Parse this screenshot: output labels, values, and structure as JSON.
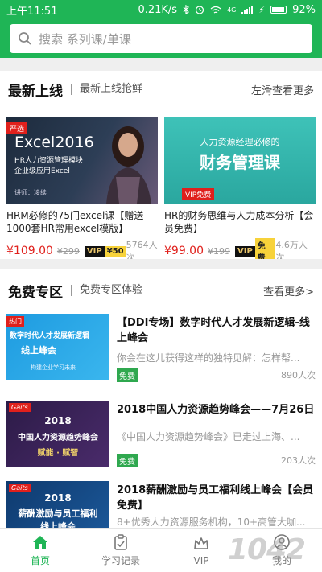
{
  "status_bar": {
    "time": "上午11:51",
    "speed": "0.21K/s",
    "net": "4G",
    "battery": "92%"
  },
  "search": {
    "placeholder": "搜索 系列课/单课"
  },
  "new_section": {
    "title": "最新上线",
    "subtitle": "最新上线抢鲜",
    "more": "左滑查看更多"
  },
  "new_courses": [
    {
      "title": "HRM必修的75门excel课【赠送1000套HR常用excel模版】",
      "price": "¥109.00",
      "old_price": "¥299",
      "vip_label": "VIP",
      "vip_value": "¥50",
      "count": "5764人次",
      "thumb": {
        "badge": "严选",
        "heading": "Excel2016",
        "line1": "HR人力资源管理模块",
        "line2": "企业级应用Excel",
        "teacher": "讲师：凌续"
      }
    },
    {
      "title": "HR的财务思维与人力成本分析【会员免费】",
      "price": "¥99.00",
      "old_price": "¥199",
      "vip_label": "VIP",
      "vip_value": "免费",
      "count": "4.6万人次",
      "thumb": {
        "line1": "人力资源经理必修的",
        "heading": "财务管理课",
        "tag": "VIP免费"
      }
    }
  ],
  "free_section": {
    "title": "免费专区",
    "subtitle": "免费专区体验",
    "more": "查看更多>"
  },
  "free_courses": [
    {
      "title": "【DDI专场】数字时代人才发展新逻辑-线上峰会",
      "desc": "你会在这儿获得这样的独特见解：怎样帮...",
      "badge": "免费",
      "count": "890人次",
      "thumb": {
        "corner": "热门",
        "line1": "数字时代人才发展新逻辑",
        "line2": "线上峰会",
        "line3": "构建企业学习未来"
      }
    },
    {
      "title": "2018中国人力资源趋势峰会——7月26日",
      "desc": "《中国人力资源趋势峰会》已走过上海、...",
      "badge": "免费",
      "count": "203人次",
      "thumb": {
        "corner": "Gaits",
        "line1": "2018",
        "line2": "中国人力资源趋势峰会",
        "line3": "赋能 · 赋智"
      }
    },
    {
      "title": "2018薪酬激励与员工福利线上峰会【会员免费】",
      "desc": "8+优秀人力资源服务机构，10+高管大咖...",
      "thumb": {
        "corner": "Gaits",
        "line1": "2018",
        "line2": "薪酬激励与员工福利",
        "line3": "线上峰会"
      }
    }
  ],
  "tabs": [
    {
      "label": "首页",
      "icon": "home-icon"
    },
    {
      "label": "学习记录",
      "icon": "clipboard-icon"
    },
    {
      "label": "VIP",
      "icon": "crown-icon"
    },
    {
      "label": "我的",
      "icon": "person-icon"
    }
  ],
  "watermark": "1042",
  "colors": {
    "brand_green": "#1fb556",
    "price_red": "#e0201c",
    "vip_gold": "#f7d23a"
  }
}
